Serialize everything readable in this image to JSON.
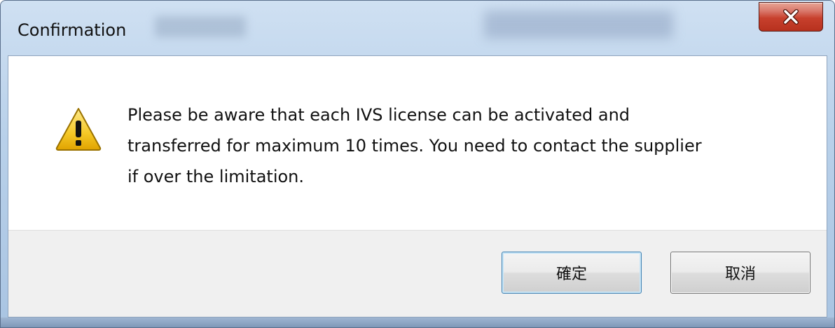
{
  "window": {
    "title": "Confirmation",
    "close_icon": "close-icon"
  },
  "message": {
    "icon": "warning-icon",
    "text": "Please be aware that each IVS license can be activated and\ntransferred for maximum 10 times. You need to contact the supplier\nif over the limitation."
  },
  "buttons": {
    "ok_label": "確定",
    "cancel_label": "取消"
  },
  "colors": {
    "close_button": "#c7402d",
    "warning_fill": "#f5c826",
    "footer_bg": "#f0f0f0"
  }
}
